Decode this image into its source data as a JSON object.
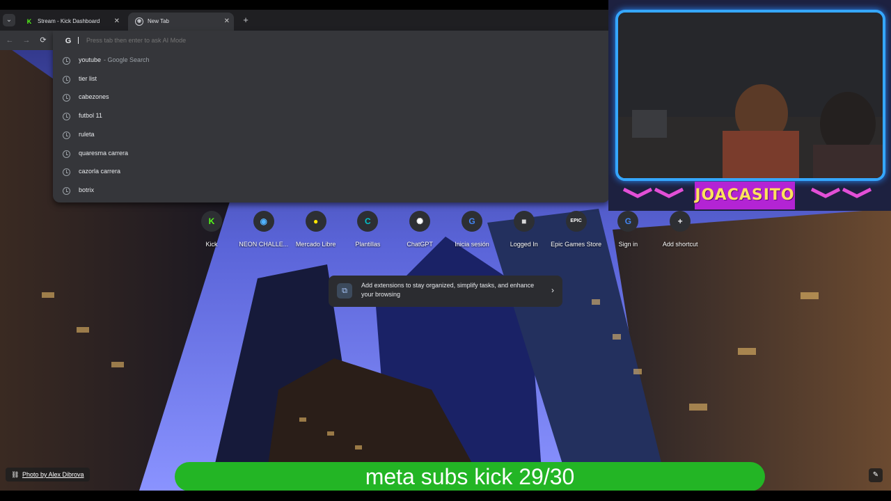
{
  "browser": {
    "tabs": [
      {
        "label": "Stream - Kick Dashboard",
        "active": false
      },
      {
        "label": "New Tab",
        "active": true
      }
    ]
  },
  "omnibox": {
    "placeholder": "Press tab then enter to ask AI Mode",
    "suggestions": [
      {
        "text": "youtube",
        "sub": "- Google Search"
      },
      {
        "text": "tier list",
        "sub": ""
      },
      {
        "text": "cabezones",
        "sub": ""
      },
      {
        "text": "futbol 11",
        "sub": ""
      },
      {
        "text": "ruleta",
        "sub": ""
      },
      {
        "text": "quaresma carrera",
        "sub": ""
      },
      {
        "text": "cazorla carrera",
        "sub": ""
      },
      {
        "text": "botrix",
        "sub": ""
      }
    ]
  },
  "shortcuts": [
    {
      "label": "Kick",
      "glyph": "K",
      "color": "#53fc18"
    },
    {
      "label": "NEON CHALLE...",
      "glyph": "◉",
      "color": "#4fb3ff"
    },
    {
      "label": "Mercado Libre",
      "glyph": "●",
      "color": "#ffe600"
    },
    {
      "label": "Plantillas",
      "glyph": "C",
      "color": "#00c4cc"
    },
    {
      "label": "ChatGPT",
      "glyph": "✺",
      "color": "#ffffff"
    },
    {
      "label": "Inicia sesión",
      "glyph": "G",
      "color": "#4285f4"
    },
    {
      "label": "Logged In",
      "glyph": "■",
      "color": "#d8d8d8"
    },
    {
      "label": "Epic Games Store",
      "glyph": "EPIC",
      "color": "#ffffff"
    },
    {
      "label": "Sign in",
      "glyph": "G",
      "color": "#4285f4"
    },
    {
      "label": "Add shortcut",
      "glyph": "+",
      "color": "#e8eaed"
    }
  ],
  "promo": {
    "text": "Add extensions to stay organized, simplify tasks, and enhance your browsing"
  },
  "photo_credit": "Photo by Alex Dibrova",
  "overlay": {
    "streamer_name": "JOACASITO",
    "subs_banner": "meta subs kick 29/30"
  },
  "icons": {
    "google": "G",
    "history": "clock-icon",
    "back": "←",
    "forward": "→",
    "reload": "⟳"
  }
}
